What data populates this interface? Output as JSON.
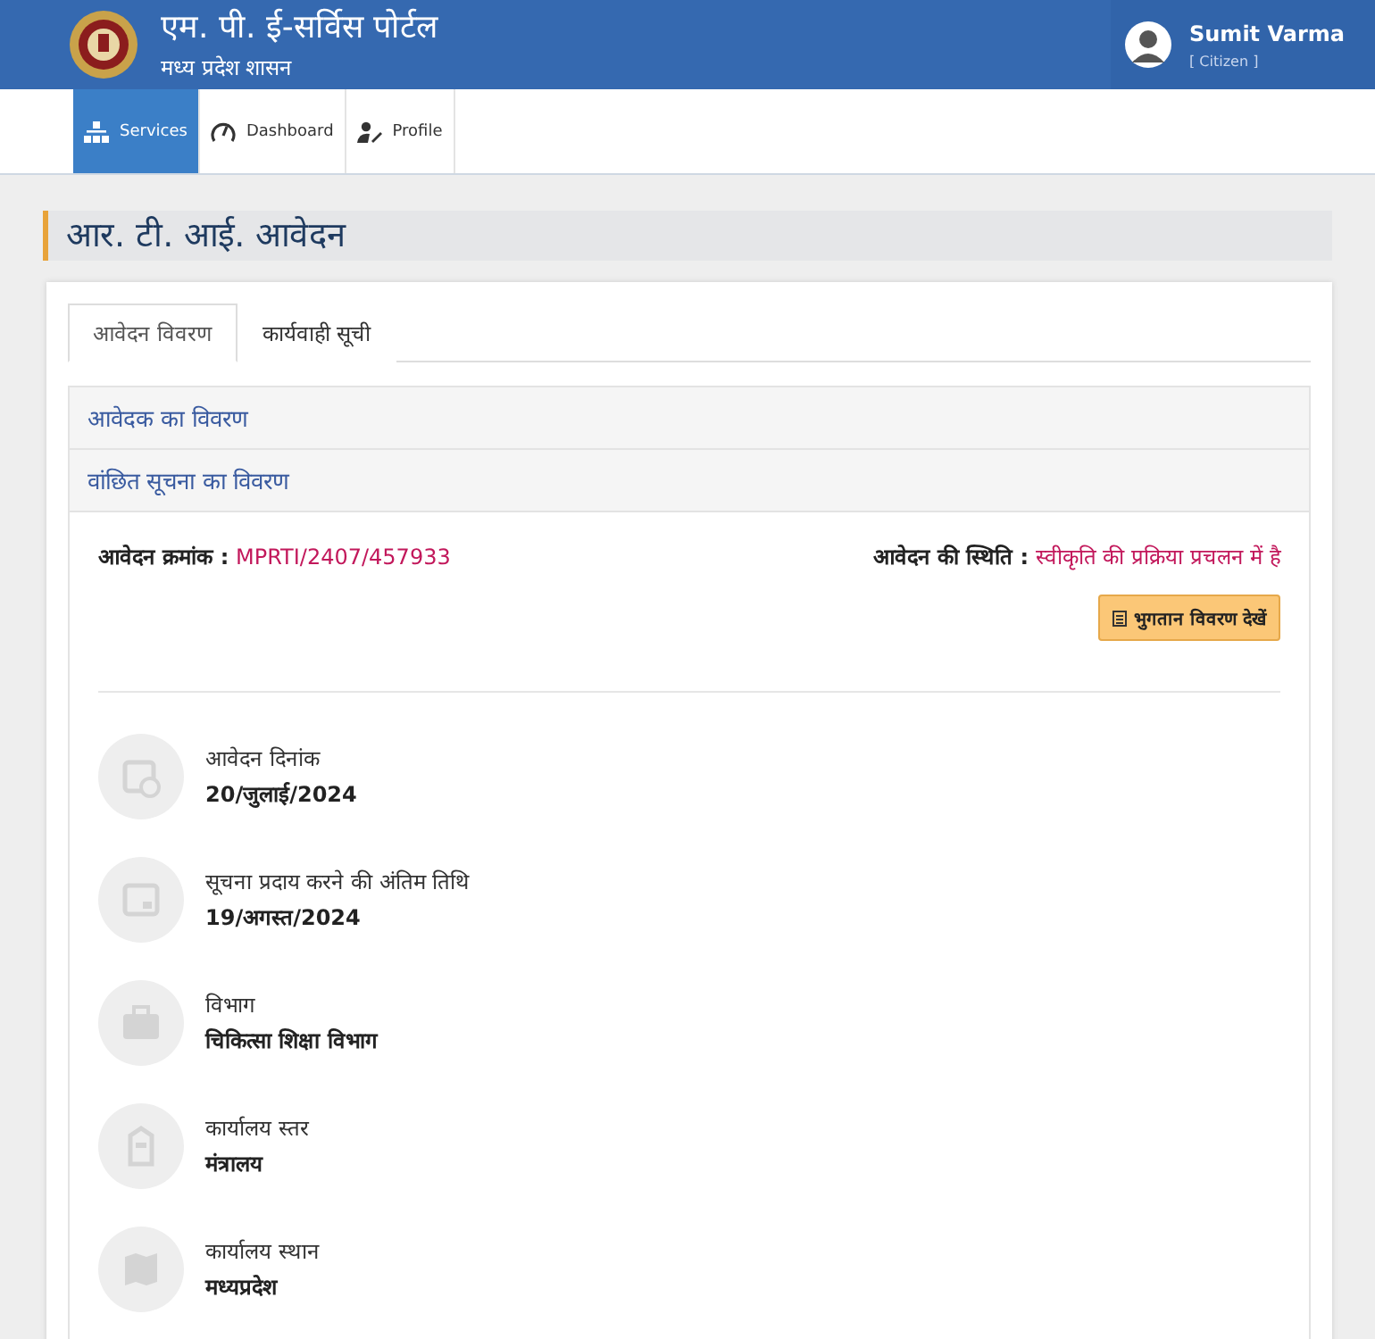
{
  "header": {
    "title": "एम. पी. ई-सर्विस पोर्टल",
    "subtitle": "मध्य प्रदेश शासन",
    "user": {
      "name": "Sumit Varma",
      "role": "[ Citizen ]"
    }
  },
  "nav": [
    {
      "label": "Services",
      "kind": "sitemap",
      "selected": true
    },
    {
      "label": "Dashboard",
      "kind": "gauge",
      "selected": false
    },
    {
      "label": "Profile",
      "kind": "user-edit",
      "selected": false
    }
  ],
  "page_title": "आर. टी. आई. आवेदन",
  "tabs": [
    {
      "label": "आवेदन विवरण",
      "selected": true
    },
    {
      "label": "कार्यवाही सूची",
      "selected": false
    }
  ],
  "sections": [
    {
      "title": "आवेदक का विवरण"
    },
    {
      "title": "वांछित सूचना का विवरण"
    }
  ],
  "application": {
    "number_label": "आवेदन क्रमांक :",
    "number": "MPRTI/2407/457933",
    "status_label": "आवेदन की स्थिति :",
    "status": "स्वीकृति की प्रक्रिया प्रचलन में है",
    "button": "भुगतान विवरण देखें"
  },
  "details": [
    {
      "kind": "calendar-clock",
      "label": "आवेदन दिनांक",
      "value": "20/जुलाई/2024"
    },
    {
      "kind": "calendar",
      "label": "सूचना प्रदाय करने की अंतिम तिथि",
      "value": "19/अगस्त/2024"
    },
    {
      "kind": "briefcase",
      "label": "विभाग",
      "value": "चिकित्सा शिक्षा विभाग"
    },
    {
      "kind": "building",
      "label": "कार्यालय स्तर",
      "value": "मंत्रालय"
    },
    {
      "kind": "map",
      "label": "कार्यालय स्थान",
      "value": "मध्यप्रदेश"
    }
  ]
}
